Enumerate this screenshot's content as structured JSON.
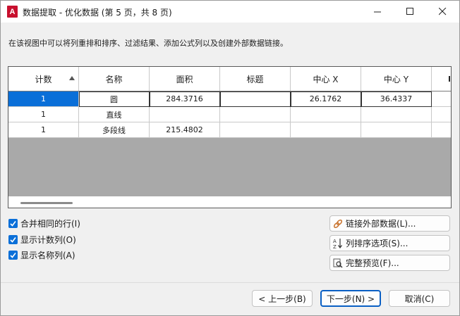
{
  "window": {
    "title": "数据提取 - 优化数据 (第 5 页，共 8 页)",
    "app_icon_letter": "A",
    "minimize_label": "—",
    "maximize_label": "☐",
    "close_label": "✕"
  },
  "description": "在该视图中可以将列重排和排序、过滤结果、添加公式列以及创建外部数据链接。",
  "grid": {
    "columns": [
      "计数",
      "名称",
      "面积",
      "标题",
      "中心 X",
      "中心 Y",
      ""
    ],
    "sorted_column": "计数",
    "rows": [
      [
        "1",
        "圆",
        "284.3716",
        "",
        "26.1762",
        "36.4337",
        ""
      ],
      [
        "1",
        "直线",
        "",
        "",
        "",
        "",
        ""
      ],
      [
        "1",
        "多段线",
        "215.4802",
        "",
        "",
        "",
        ""
      ]
    ]
  },
  "options": {
    "combine_rows": "合并相同的行(I)",
    "show_count": "显示计数列(O)",
    "show_name": "显示名称列(A)",
    "combine_rows_checked": true,
    "show_count_checked": true,
    "show_name_checked": true
  },
  "side_buttons": {
    "link_external": "链接外部数据(L)...",
    "sort_columns": "列排序选项(S)...",
    "full_preview": "完整预览(F)..."
  },
  "nav": {
    "back": "< 上一步(B)",
    "next": "下一步(N) >",
    "cancel": "取消(C)"
  },
  "colors": {
    "accent": "#0a6fd8",
    "app_icon": "#c8102e",
    "grid_background": "#a9a9a9"
  }
}
